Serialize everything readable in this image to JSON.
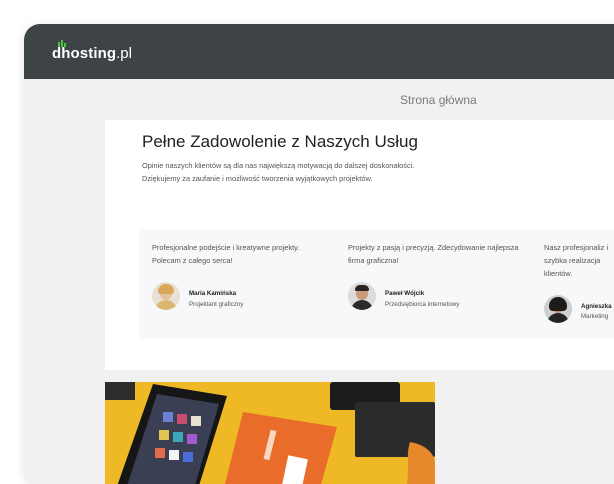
{
  "header": {
    "logo_name": "dhosting",
    "logo_tld": ".pl"
  },
  "breadcrumb": {
    "label": "Strona główna"
  },
  "section": {
    "title": "Pełne Zadowolenie z Naszych Usług",
    "description": "Opinie naszych klientów są dla nas największą motywacją do dalszej doskonałości. Dziękujemy za zaufanie i możliwość tworzenia wyjątkowych projektów."
  },
  "reviews": [
    {
      "text": "Profesjonalne podejście i kreatywne projekty. Polecam z całego serca!",
      "name": "Maria Kamińska",
      "role": "Projektant graficzny"
    },
    {
      "text": "Projekty z pasją i precyzją. Zdecydowanie najlepsza firma graficzna!",
      "name": "Paweł Wójcik",
      "role": "Przedsiębiorca internetowy"
    },
    {
      "text": "Nasz profesjonaliz i szybka realizacja klientów.",
      "name": "Agnieszka",
      "role": "Marketing"
    }
  ],
  "colors": {
    "topbar": "#3e4345",
    "logo_accent": "#4fc04a",
    "photo_yellow": "#efb925",
    "book_orange": "#e96c2a"
  }
}
